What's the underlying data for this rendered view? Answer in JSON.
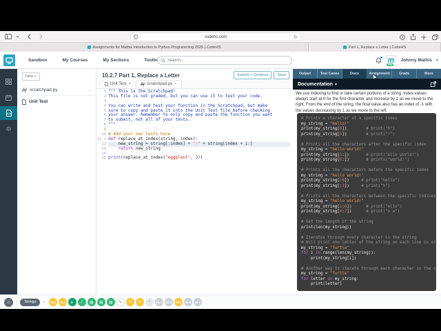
{
  "browser": {
    "address": "codehs.com",
    "tabs": [
      "Assignments for Mathis Introduction to Python Programming 2025 | CodeHS",
      "Part 1, Replace a Letter | CodeHS"
    ]
  },
  "header": {
    "nav": [
      "Sandbox",
      "My Courses",
      "My Sections",
      "Toolbox"
    ],
    "search_placeholder": "Search...",
    "user_name": "Johnny Mathis",
    "pro_badge": "Pro"
  },
  "file_panel": {
    "new_button": "New +",
    "files": [
      "scratchpad.py",
      "Unit Test"
    ]
  },
  "editor": {
    "title": "10.2.7 Part 1, Replace a Letter",
    "submit_button": "Submit + Continue",
    "save_button": "Save",
    "tabs": [
      "Unit Test",
      "scratchpad.py"
    ],
    "active_tab": "scratchpad.py",
    "highlight_line": 12,
    "fold_line": 11,
    "lines": [
      [
        [
          "d",
          "\"\"\" This is the Scratchpad!"
        ]
      ],
      [
        [
          "d",
          "This file is not graded, but you can use it to test your code."
        ]
      ],
      [],
      [
        [
          "d",
          "You can write and test your function in the Scratchpad, but make"
        ]
      ],
      [
        [
          "d",
          "sure to copy and paste it into the Unit Test file before checking"
        ]
      ],
      [
        [
          "d",
          "your answer. Remember to only copy and paste the function you want"
        ]
      ],
      [
        [
          "d",
          "to submit, not all of your tests."
        ]
      ],
      [
        [
          "d",
          "\"\"\""
        ]
      ],
      [],
      [
        [
          "c",
          "# Add your own tests here"
        ]
      ],
      [
        [
          "k",
          "def"
        ],
        [
          "p",
          " replace_at_index(string, index):"
        ]
      ],
      [
        [
          "p",
          "    new_string = string[:index] + "
        ],
        [
          "s",
          "\"-\""
        ],
        [
          "p",
          " + string[index + "
        ],
        [
          "n",
          "1"
        ],
        [
          "p",
          ":]"
        ]
      ],
      [
        [
          "p",
          "    "
        ],
        [
          "k",
          "return"
        ],
        [
          "p",
          " new_string"
        ]
      ],
      [],
      [
        [
          "f",
          "print"
        ],
        [
          "p",
          "(replace_at_index("
        ],
        [
          "s",
          "\"eggplant\""
        ],
        [
          "p",
          ", "
        ],
        [
          "n",
          "3"
        ],
        [
          "p",
          "))"
        ]
      ]
    ]
  },
  "right_panel": {
    "tabs": [
      "Output",
      "Test Cases",
      "Docs",
      "Assignment",
      "Grade",
      "More"
    ],
    "active_tab": "Docs",
    "doc_header": "Documentation",
    "paragraph": "We use indexing to find or take certain portions of a string. Index values always start at 0 for the first character and increase by 1 as we move to the right. From the end of the string, the final value also has an index of -1 with the values decreasing by 1 as we move to the left.",
    "code_lines": [
      [
        [
          "c",
          "# Prints a character at a specific index"
        ]
      ],
      [
        [
          "p",
          "my_string = "
        ],
        [
          "s",
          "\"hello!\""
        ]
      ],
      [
        [
          "p",
          "print(my_string["
        ],
        [
          "n",
          "0"
        ],
        [
          "p",
          "])"
        ],
        [
          "c",
          "        # print(\"h\")"
        ]
      ],
      [
        [
          "p",
          "print(my_string["
        ],
        [
          "n",
          "5"
        ],
        [
          "p",
          "])"
        ],
        [
          "c",
          "        # print(\"!\")"
        ]
      ],
      [],
      [
        [
          "c",
          "# Prints all the characters after the specific index"
        ]
      ],
      [
        [
          "p",
          "my_string = "
        ],
        [
          "s",
          "\"hello world!\""
        ]
      ],
      [
        [
          "p",
          "print(my_string["
        ],
        [
          "n",
          "1"
        ],
        [
          "p",
          ":])"
        ],
        [
          "c",
          "       # print(\"ello world!\")"
        ]
      ],
      [
        [
          "p",
          "print(my_string["
        ],
        [
          "n",
          "6"
        ],
        [
          "p",
          ":])"
        ],
        [
          "c",
          "       # prints(\"world!\")"
        ]
      ],
      [],
      [
        [
          "c",
          "# Prints all the characters before the specific index"
        ]
      ],
      [
        [
          "p",
          "my_string = "
        ],
        [
          "s",
          "\"hello world!\""
        ]
      ],
      [
        [
          "p",
          "print(my_string[:"
        ],
        [
          "n",
          "6"
        ],
        [
          "p",
          "])"
        ],
        [
          "c",
          "     # print(\"hello\")"
        ]
      ],
      [
        [
          "p",
          "print(my_string[:"
        ],
        [
          "n",
          "1"
        ],
        [
          "p",
          "])"
        ],
        [
          "c",
          "     # print(\"h\")"
        ]
      ],
      [],
      [
        [
          "c",
          "# Prints all the characters between the specific indices"
        ]
      ],
      [
        [
          "p",
          "my_string = "
        ],
        [
          "s",
          "\"hello world!\""
        ]
      ],
      [
        [
          "p",
          "print(my_string["
        ],
        [
          "n",
          "1"
        ],
        [
          "p",
          ":"
        ],
        [
          "n",
          "6"
        ],
        [
          "p",
          "])"
        ],
        [
          "c",
          "      # print(\"ello\")"
        ]
      ],
      [
        [
          "p",
          "print(my_string["
        ],
        [
          "n",
          "4"
        ],
        [
          "p",
          ":"
        ],
        [
          "n",
          "7"
        ],
        [
          "p",
          "])"
        ],
        [
          "c",
          "      # print(\"o w\")"
        ]
      ],
      [],
      [
        [
          "c",
          "# Get the length of the string"
        ]
      ],
      [
        [
          "p",
          "print(len(my_string))"
        ]
      ],
      [],
      [
        [
          "c",
          "# Iterates through every character in the string"
        ]
      ],
      [
        [
          "c",
          "# Will print one letter of the string on each line in order"
        ]
      ],
      [
        [
          "p",
          "my_string = "
        ],
        [
          "s",
          "\"Turtle\""
        ]
      ],
      [
        [
          "k",
          "for"
        ],
        [
          "p",
          " i "
        ],
        [
          "k",
          "in"
        ],
        [
          "p",
          " range(len(my_string)):"
        ]
      ],
      [
        [
          "p",
          "    print(my_string[i])"
        ]
      ],
      [],
      [
        [
          "c",
          "# Another way to iterate through each character in the string"
        ]
      ],
      [
        [
          "p",
          "my_string = "
        ],
        [
          "s",
          "\"Turtle\""
        ]
      ],
      [
        [
          "k",
          "for"
        ],
        [
          "p",
          " letter "
        ],
        [
          "k",
          "in"
        ],
        [
          "p",
          " my_string:"
        ]
      ],
      [
        [
          "p",
          "    print(letter)"
        ]
      ]
    ]
  },
  "dock": {
    "home_icon": "⌂",
    "separator": "›",
    "section_label": "Strings",
    "badges": [
      {
        "label": "10.1",
        "style": "yellow"
      },
      {
        "label": "10.2",
        "style": "yellow"
      },
      {
        "icon": "video",
        "style": "green-dark"
      },
      {
        "icon": "check",
        "style": "green"
      },
      {
        "icon": "doc",
        "style": "green"
      },
      {
        "icon": "doc",
        "style": "green"
      },
      {
        "icon": "doc",
        "style": "green"
      },
      {
        "icon": "pencil",
        "style": "white-teal"
      },
      {
        "icon": "pencil",
        "style": "yellow"
      },
      {
        "icon": "pencil",
        "style": "yellow"
      },
      {
        "icon": "dot",
        "style": "gray-light"
      },
      {
        "label": "10.3",
        "style": "gray"
      },
      {
        "label": "10.4",
        "style": "gray"
      },
      {
        "label": "10.5",
        "style": "yellow"
      },
      {
        "label": "10.6",
        "style": "gray"
      },
      {
        "label": "10.7",
        "style": "gray"
      }
    ]
  },
  "icons": {
    "check": "✓",
    "pencil": "✎",
    "video": "▸",
    "doc": "▤",
    "dot": "•",
    "gear": "⚙",
    "chevron_down": "▾",
    "close": "×",
    "reload": "↻",
    "caret": "⌄"
  },
  "colors": {
    "accent_teal": "#3e93a8",
    "yellow": "#f8c63d",
    "green": "#31b877",
    "rail_dark": "#2b3944",
    "panel_teal": "#37637e"
  }
}
